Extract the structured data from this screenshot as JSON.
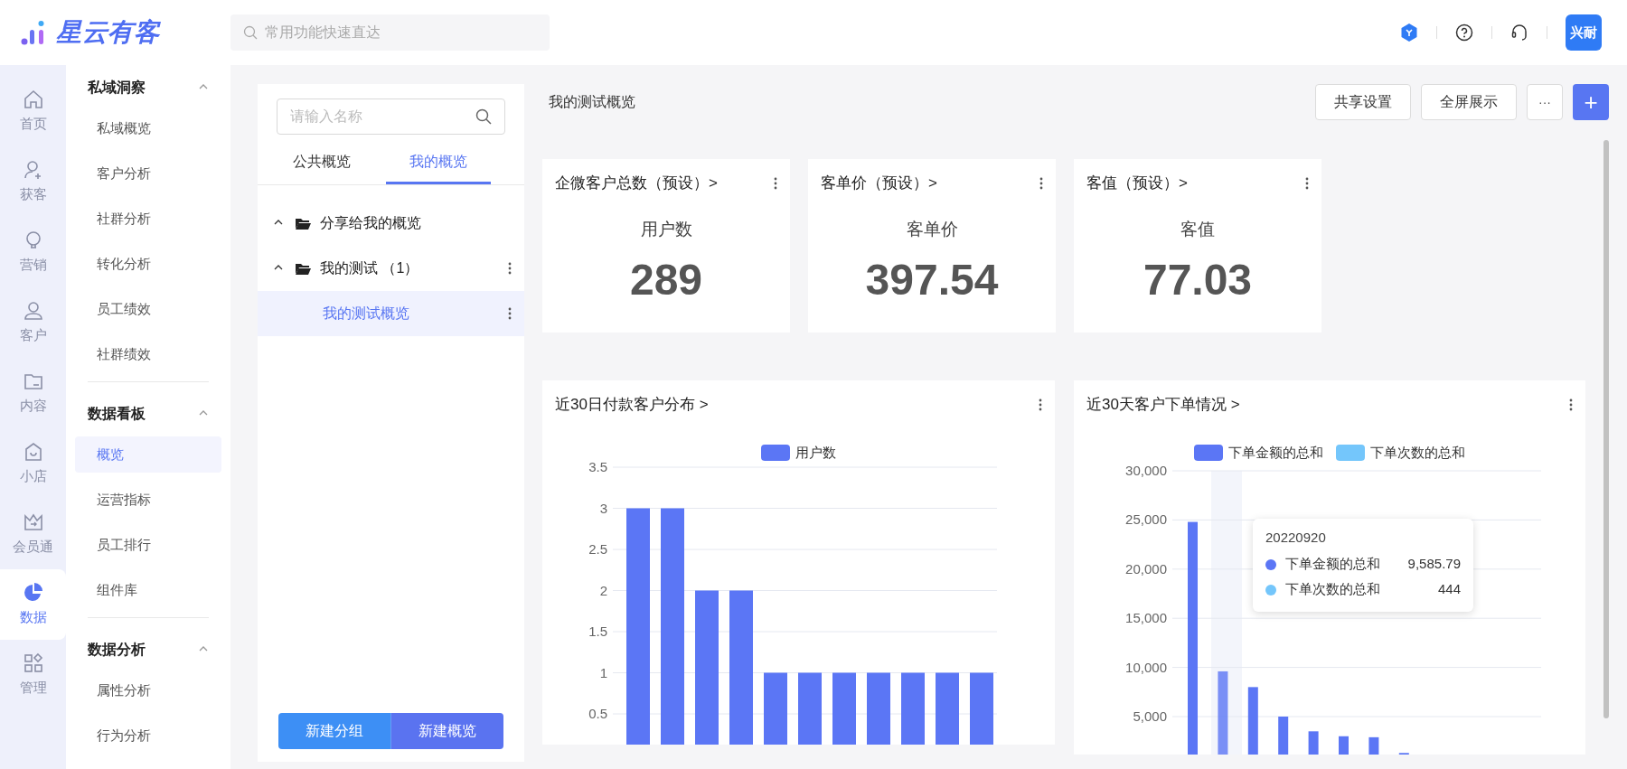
{
  "header": {
    "brand": "星云有客",
    "search": {
      "placeholder": "常用功能快速直达"
    },
    "avatar": "兴耐"
  },
  "rail": [
    {
      "label": "首页",
      "selected": false
    },
    {
      "label": "获客",
      "selected": false
    },
    {
      "label": "营销",
      "selected": false
    },
    {
      "label": "客户",
      "selected": false
    },
    {
      "label": "内容",
      "selected": false
    },
    {
      "label": "小店",
      "selected": false
    },
    {
      "label": "会员通",
      "selected": false
    },
    {
      "label": "数据",
      "selected": true
    },
    {
      "label": "管理",
      "selected": false
    }
  ],
  "sidebar": {
    "groups": [
      {
        "title": "私域洞察",
        "expanded": true,
        "items": [
          {
            "label": "私域概览",
            "selected": false
          },
          {
            "label": "客户分析",
            "selected": false
          },
          {
            "label": "社群分析",
            "selected": false
          },
          {
            "label": "转化分析",
            "selected": false
          },
          {
            "label": "员工绩效",
            "selected": false
          },
          {
            "label": "社群绩效",
            "selected": false
          }
        ]
      },
      {
        "title": "数据看板",
        "expanded": true,
        "items": [
          {
            "label": "概览",
            "selected": true
          },
          {
            "label": "运营指标",
            "selected": false
          },
          {
            "label": "员工排行",
            "selected": false
          },
          {
            "label": "组件库",
            "selected": false
          }
        ]
      },
      {
        "title": "数据分析",
        "expanded": true,
        "items": [
          {
            "label": "属性分析",
            "selected": false
          },
          {
            "label": "行为分析",
            "selected": false
          }
        ]
      }
    ]
  },
  "panel": {
    "search": {
      "placeholder": "请输入名称"
    },
    "tabs": [
      {
        "label": "公共概览",
        "selected": false
      },
      {
        "label": "我的概览",
        "selected": true
      }
    ],
    "tree": [
      {
        "kind": "folder",
        "label": "分享给我的概览",
        "expanded": true,
        "menu": false,
        "selected": false
      },
      {
        "kind": "folder",
        "label": "我的测试 （1）",
        "expanded": true,
        "menu": true,
        "selected": false,
        "children": [
          {
            "kind": "overview",
            "label": "我的测试概览",
            "menu": true,
            "selected": true
          }
        ]
      }
    ],
    "buttons": [
      "新建分组",
      "新建概览"
    ]
  },
  "dashboard": {
    "title": "我的测试概览",
    "buttons": [
      "共享设置",
      "全屏展示"
    ],
    "more": "···",
    "add": "+",
    "stats": [
      {
        "title": "企微客户总数（预设）>",
        "label": "用户数",
        "value": "289"
      },
      {
        "title": "客单价（预设）>",
        "label": "客单价",
        "value": "397.54"
      },
      {
        "title": "客值（预设）>",
        "label": "客值",
        "value": "77.03"
      }
    ],
    "charts": [
      {
        "title": "近30日付款客户分布 >",
        "chart_data": {
          "type": "bar",
          "series": [
            {
              "name": "用户数",
              "color": "#5b76f5",
              "values": [
                3,
                3,
                2,
                2,
                1,
                1,
                1,
                1,
                1,
                1,
                1
              ]
            }
          ],
          "legend": "top",
          "ylim": [
            0,
            3.5
          ],
          "grid": true,
          "yticks": [
            0.5,
            1,
            1.5,
            2,
            2.5,
            3,
            3.5
          ]
        }
      },
      {
        "title": "近30天客户下单情况 >",
        "chart_data": {
          "type": "bar",
          "grid": true,
          "legend": "top",
          "ylim": [
            0,
            30000
          ],
          "series": [
            {
              "name": "下单金额的总和",
              "color": "#5b76f5",
              "values": [
                24800,
                9600,
                8000,
                5000,
                3500,
                3000,
                2900,
                1300,
                null,
                null,
                null,
                null
              ]
            },
            {
              "name": "下单次数的总和",
              "color": "#74c6fb",
              "values": [
                null,
                null,
                null,
                null,
                null,
                null,
                null,
                null,
                null,
                null,
                null,
                null
              ]
            }
          ],
          "yticks": [
            {
              "value": 5000,
              "label": "5,000"
            },
            {
              "value": 10000,
              "label": "10,000"
            },
            {
              "value": 15000,
              "label": "15,000"
            },
            {
              "value": 20000,
              "label": "20,000"
            },
            {
              "value": 25000,
              "label": "25,000"
            },
            {
              "value": 30000,
              "label": "30,000"
            }
          ]
        },
        "tooltip": {
          "title": "20220920",
          "rows": [
            {
              "label": "下单金额的总和",
              "value": "9,585.79",
              "color": "#5b76f5"
            },
            {
              "label": "下单次数的总和",
              "value": "444",
              "color": "#74c6fb"
            }
          ]
        }
      }
    ]
  }
}
